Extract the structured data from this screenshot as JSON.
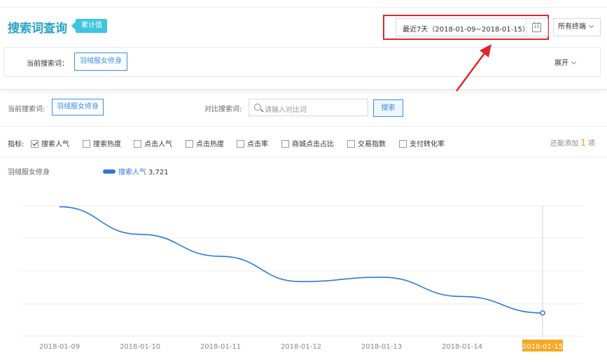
{
  "header": {
    "title": "搜索词查询",
    "badge": "累计值",
    "date_range": "最近7天（2018-01-09~2018-01-15）",
    "calendar_day": "15",
    "terminal": "所有终端"
  },
  "search_panel": {
    "label": "当前搜索词：",
    "term": "羽绒服女修身",
    "expand": "展开"
  },
  "compare": {
    "current_label": "当前搜索词:",
    "current_term": "羽绒服女修身",
    "compare_label": "对比搜索词:",
    "placeholder": "请输入对比词",
    "search_button": "搜索"
  },
  "metrics": {
    "label": "指标:",
    "items": [
      {
        "label": "搜索人气",
        "checked": true
      },
      {
        "label": "搜索热度",
        "checked": false
      },
      {
        "label": "点击人气",
        "checked": false
      },
      {
        "label": "点击热度",
        "checked": false
      },
      {
        "label": "点击率",
        "checked": false
      },
      {
        "label": "商城点击占比",
        "checked": false
      },
      {
        "label": "交易指数",
        "checked": false
      },
      {
        "label": "支付转化率",
        "checked": false
      }
    ],
    "add_more_prefix": "还能添加",
    "add_more_count": "1",
    "add_more_suffix": "项"
  },
  "chart_data": {
    "type": "line",
    "title": "羽绒服女修身",
    "x": [
      "2018-01-09",
      "2018-01-10",
      "2018-01-11",
      "2018-01-12",
      "2018-01-13",
      "2018-01-14",
      "2018-01-15"
    ],
    "series": [
      {
        "name": "搜索人气",
        "values": [
          5350,
          4850,
          4450,
          3990,
          4070,
          3720,
          3420
        ],
        "color": "#2e78db"
      }
    ],
    "legend_value": "3,721",
    "highlight_index": 6,
    "highlight_color": "#f7a823",
    "ylim": [
      3000,
      5800
    ],
    "grid": true,
    "legend_position": "top-left"
  }
}
